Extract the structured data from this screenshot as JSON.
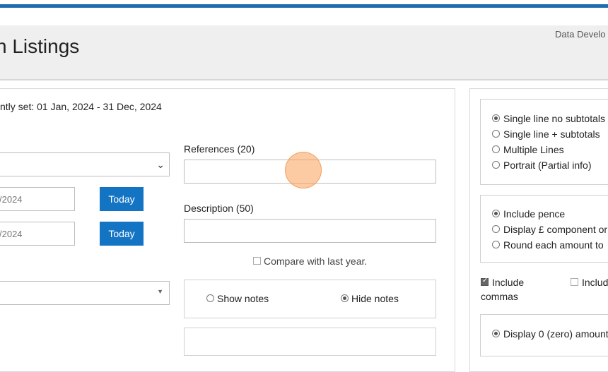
{
  "header": {
    "title": "n Listings",
    "user_text": "Data Develo"
  },
  "period": {
    "text": "ntly set: 01 Jan, 2024 - 31 Dec, 2024"
  },
  "form": {
    "date_from_value": "/2024",
    "date_to_value": "/2024",
    "today_label": "Today",
    "references_label": "References (20)",
    "references_value": "",
    "description_label": "Description (50)",
    "description_value": "",
    "compare_label": "Compare with last year.",
    "compare_checked": false,
    "notes": {
      "show_label": "Show notes",
      "hide_label": "Hide notes",
      "selected": "hide"
    }
  },
  "layout_options": {
    "items": [
      {
        "label": "Single line no subtotals",
        "checked": true
      },
      {
        "label": "Single line + subtotals",
        "checked": false
      },
      {
        "label": "Multiple Lines",
        "checked": false
      },
      {
        "label": "Portrait (Partial info)",
        "checked": false
      }
    ]
  },
  "amount_options": {
    "items": [
      {
        "label": "Include pence",
        "checked": true
      },
      {
        "label": "Display £ component or",
        "checked": false
      },
      {
        "label": "Round each amount to",
        "checked": false
      }
    ]
  },
  "comma_options": {
    "include_commas_label_1": "Include",
    "include_commas_label_2": "commas",
    "include_commas_checked": true,
    "other_label": "Includ",
    "other_checked": false
  },
  "zero_options": {
    "item_label": "Display 0 (zero) amount",
    "checked": true
  }
}
